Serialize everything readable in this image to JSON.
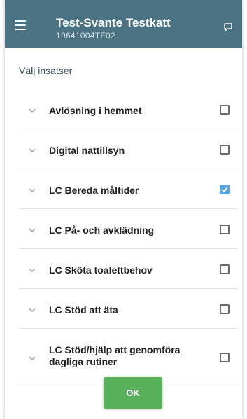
{
  "header": {
    "title": "Test-Svante Testkatt",
    "subtitle": "19641004TF02",
    "color": "#4a7283",
    "menu_icon": "hamburger-menu-icon",
    "chat_icon": "chat-bubble-icon"
  },
  "section": {
    "heading": "Välj insatser"
  },
  "items": [
    {
      "label": "Avlösning i hemmet",
      "checked": false
    },
    {
      "label": "Digital nattillsyn",
      "checked": false
    },
    {
      "label": "LC Bereda måltider",
      "checked": true
    },
    {
      "label": "LC På- och avklädning",
      "checked": false
    },
    {
      "label": "LC Sköta toalettbehov",
      "checked": false
    },
    {
      "label": "LC Stöd att äta",
      "checked": false
    },
    {
      "label": "LC Stöd/hjälp att genomföra dagliga rutiner",
      "checked": false
    }
  ],
  "ok_button": {
    "label": "OK",
    "color": "#58b25c"
  },
  "checkbox_checked_color": "#56a3e0"
}
